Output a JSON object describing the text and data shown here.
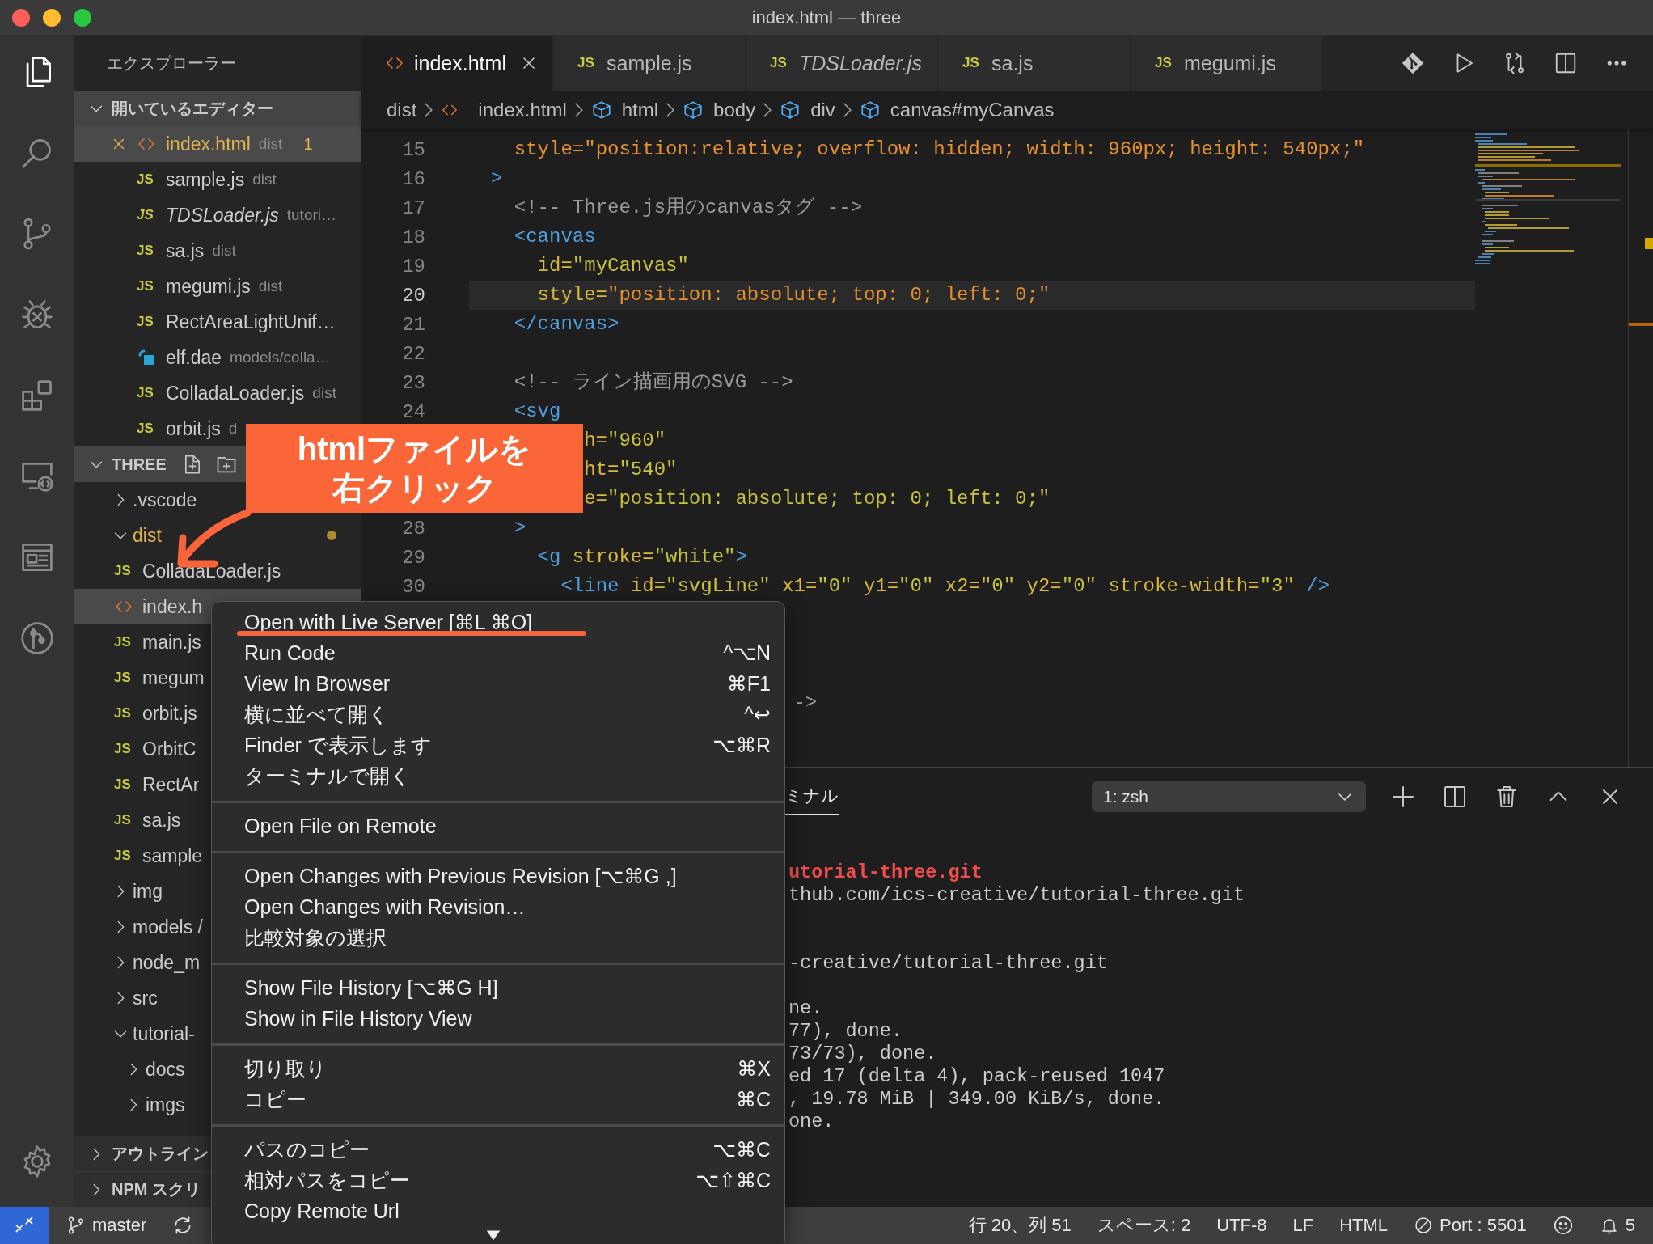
{
  "window": {
    "title": "index.html — three"
  },
  "activity_bar": {
    "items": [
      {
        "kind": "explorer",
        "selected": true
      },
      {
        "kind": "search",
        "selected": false
      },
      {
        "kind": "source-control",
        "selected": false
      },
      {
        "kind": "debug",
        "selected": false
      },
      {
        "kind": "extensions",
        "selected": false
      },
      {
        "kind": "remote",
        "selected": false
      },
      {
        "kind": "preview",
        "selected": false
      },
      {
        "kind": "git-graph",
        "selected": false
      },
      {
        "kind": "settings",
        "selected": false
      }
    ]
  },
  "sidebar": {
    "title": "エクスプローラー",
    "open_editors": {
      "title": "開いているエディター",
      "expanded": true,
      "items": [
        {
          "name": "index.html",
          "description": "dist",
          "kind": "html",
          "badge": "1",
          "selected": true,
          "preview": false,
          "modified": true
        },
        {
          "name": "sample.js",
          "description": "dist",
          "kind": "js",
          "icon": "JS",
          "selected": false,
          "preview": false,
          "modified": false
        },
        {
          "name": "TDSLoader.js",
          "description": "tutori…",
          "kind": "js",
          "icon": "JS",
          "selected": false,
          "preview": true,
          "modified": false
        },
        {
          "name": "sa.js",
          "description": "dist",
          "kind": "js",
          "icon": "JS",
          "selected": false,
          "preview": false,
          "modified": false
        },
        {
          "name": "megumi.js",
          "description": "dist",
          "kind": "js",
          "icon": "JS",
          "selected": false,
          "preview": false,
          "modified": false
        },
        {
          "name": "RectAreaLightUnif…",
          "kind": "js",
          "icon": "JS",
          "selected": false,
          "preview": false,
          "modified": false
        },
        {
          "name": "elf.dae",
          "description": "models/colla…",
          "kind": "dae",
          "selected": false,
          "preview": false,
          "modified": false
        },
        {
          "name": "ColladaLoader.js",
          "description": "dist",
          "kind": "js",
          "icon": "JS",
          "selected": false,
          "preview": false,
          "modified": false
        },
        {
          "name": "orbit.js",
          "description": "d",
          "kind": "js",
          "icon": "JS",
          "selected": false,
          "preview": false,
          "modified": false
        }
      ]
    },
    "folder": {
      "title": "THREE",
      "expanded": true,
      "tree": [
        {
          "name": ".vscode",
          "kind": "folder",
          "expanded": false,
          "selected": false,
          "modified": false
        },
        {
          "name": "dist",
          "kind": "folder",
          "expanded": true,
          "selected": false,
          "modified": true,
          "children": [
            {
              "name": "ColladaLoader.js",
              "kind": "js",
              "icon": "JS",
              "selected": false,
              "modified": false
            },
            {
              "name": "index.h",
              "kind": "html",
              "selected": true,
              "modified": false
            },
            {
              "name": "main.js",
              "kind": "js",
              "icon": "JS",
              "selected": false,
              "modified": false
            },
            {
              "name": "megum",
              "kind": "js",
              "icon": "JS",
              "selected": false,
              "modified": false
            },
            {
              "name": "orbit.js",
              "kind": "js",
              "icon": "JS",
              "selected": false,
              "modified": false
            },
            {
              "name": "OrbitC",
              "kind": "js",
              "icon": "JS",
              "selected": false,
              "modified": false
            },
            {
              "name": "RectAr",
              "kind": "js",
              "icon": "JS",
              "selected": false,
              "modified": false
            },
            {
              "name": "sa.js",
              "kind": "js",
              "icon": "JS",
              "selected": false,
              "modified": false
            },
            {
              "name": "sample",
              "kind": "js",
              "icon": "JS",
              "selected": false,
              "modified": false
            }
          ]
        },
        {
          "name": "img",
          "kind": "folder",
          "expanded": false,
          "selected": false,
          "modified": false
        },
        {
          "name": "models /",
          "kind": "folder",
          "expanded": false,
          "selected": false,
          "modified": false
        },
        {
          "name": "node_m",
          "kind": "folder",
          "expanded": false,
          "selected": false,
          "modified": false
        },
        {
          "name": "src",
          "kind": "folder",
          "expanded": false,
          "selected": false,
          "modified": false
        },
        {
          "name": "tutorial-",
          "kind": "folder",
          "expanded": true,
          "selected": false,
          "modified": false,
          "children": [
            {
              "name": "docs",
              "kind": "folder",
              "expanded": false,
              "selected": false,
              "modified": false
            },
            {
              "name": "imgs",
              "kind": "folder",
              "expanded": false,
              "selected": false,
              "modified": false
            }
          ]
        }
      ]
    },
    "sections": [
      {
        "title": "アウトライン",
        "expanded": false
      },
      {
        "title": "NPM スクリ",
        "expanded": false
      }
    ]
  },
  "editor": {
    "tabs": [
      {
        "name": "index.html",
        "kind": "html",
        "selected": true,
        "preview": false
      },
      {
        "name": "sample.js",
        "kind": "js",
        "icon": "JS",
        "selected": false,
        "preview": false
      },
      {
        "name": "TDSLoader.js",
        "kind": "js",
        "icon": "JS",
        "selected": false,
        "preview": true
      },
      {
        "name": "sa.js",
        "kind": "js",
        "icon": "JS",
        "selected": false,
        "preview": false
      },
      {
        "name": "megumi.js",
        "kind": "js",
        "icon": "JS",
        "selected": false,
        "preview": false
      }
    ],
    "breadcrumbs": [
      {
        "text": "dist",
        "kind": "folder"
      },
      {
        "text": "index.html",
        "kind": "html"
      },
      {
        "text": "html",
        "kind": "element"
      },
      {
        "text": "body",
        "kind": "element"
      },
      {
        "text": "div",
        "kind": "element"
      },
      {
        "text": "canvas#myCanvas",
        "kind": "element"
      }
    ],
    "lines": [
      {
        "number": "15",
        "current": false,
        "tokens": [
          {
            "text": "  style=\"position:relative; overflow: hidden; width: 960px; height: 540px;\"",
            "kind": "css"
          }
        ]
      },
      {
        "number": "16",
        "current": false,
        "tokens": [
          {
            "text": ">",
            "kind": "tag"
          }
        ]
      },
      {
        "number": "17",
        "current": false,
        "tokens": [
          {
            "text": "  <!-- Three.js用のcanvasタグ -->",
            "kind": "comment"
          }
        ]
      },
      {
        "number": "18",
        "current": false,
        "tokens": [
          {
            "text": "  <canvas",
            "kind": "tag"
          }
        ]
      },
      {
        "number": "19",
        "current": false,
        "tokens": [
          {
            "text": "    id=",
            "kind": "attr"
          },
          {
            "text": "\"myCanvas\"",
            "kind": "string"
          }
        ]
      },
      {
        "number": "20",
        "current": true,
        "tokens": [
          {
            "text": "    style=",
            "kind": "attr"
          },
          {
            "text": "\"position: absolute; top: 0; left: 0;\"",
            "kind": "css"
          }
        ]
      },
      {
        "number": "21",
        "current": false,
        "tokens": [
          {
            "text": "  </canvas>",
            "kind": "tag"
          }
        ]
      },
      {
        "number": "22",
        "current": false
      },
      {
        "number": "23",
        "current": false,
        "tokens": [
          {
            "text": "  <!-- ライン描画用のSVG -->",
            "kind": "comment"
          }
        ]
      },
      {
        "number": "24",
        "current": false,
        "tokens": [
          {
            "text": "  <svg",
            "kind": "tag"
          }
        ]
      },
      {
        "current": false,
        "tokens": [
          {
            "text": "        h=",
            "kind": "attr"
          },
          {
            "text": "\"960\"",
            "kind": "string"
          }
        ]
      },
      {
        "current": false,
        "tokens": [
          {
            "text": "        ht=",
            "kind": "attr"
          },
          {
            "text": "\"540\"",
            "kind": "string"
          }
        ]
      },
      {
        "current": false,
        "tokens": [
          {
            "text": "        e=",
            "kind": "attr"
          },
          {
            "text": "\"position: absolute; top: 0; left: 0;\"",
            "kind": "string"
          }
        ]
      },
      {
        "number": "28",
        "current": false,
        "tokens": [
          {
            "text": "  >",
            "kind": "tag"
          }
        ]
      },
      {
        "number": "29",
        "current": false,
        "tokens": [
          {
            "text": "    <g",
            "kind": "tag"
          },
          {
            "text": " stroke=",
            "kind": "attr"
          },
          {
            "text": "\"white\"",
            "kind": "string"
          },
          {
            "text": ">",
            "kind": "tag"
          }
        ]
      },
      {
        "number": "30",
        "current": false,
        "tokens": [
          {
            "text": "      <line",
            "kind": "tag"
          },
          {
            "text": " id=",
            "kind": "attr"
          },
          {
            "text": "\"svgLine\"",
            "kind": "string"
          },
          {
            "text": " x1=",
            "kind": "attr"
          },
          {
            "text": "\"0\"",
            "kind": "string"
          },
          {
            "text": " y1=",
            "kind": "attr"
          },
          {
            "text": "\"0\"",
            "kind": "string"
          },
          {
            "text": " x2=",
            "kind": "attr"
          },
          {
            "text": "\"0\"",
            "kind": "string"
          },
          {
            "text": " y2=",
            "kind": "attr"
          },
          {
            "text": "\"0\"",
            "kind": "string"
          },
          {
            "text": " stroke-width=",
            "kind": "attr"
          },
          {
            "text": "\"3\"",
            "kind": "string"
          },
          {
            "text": " />",
            "kind": "tag"
          }
        ]
      },
      {
        "current": false
      },
      {
        "current": false
      },
      {
        "current": false
      },
      {
        "current": false,
        "tokens": [
          {
            "text": "                          ->",
            "kind": "comment"
          }
        ]
      }
    ]
  },
  "panel": {
    "tab": {
      "label": "ミナル",
      "selected": true
    },
    "terminal_select": "1: zsh",
    "lines": [
      {
        "kind": "error",
        "text": "utorial-three.git"
      },
      {
        "kind": "output",
        "text": "thub.com/ics-creative/tutorial-three.git"
      },
      {
        "kind": "blank"
      },
      {
        "kind": "blank"
      },
      {
        "kind": "output",
        "text": "-creative/tutorial-three.git"
      },
      {
        "kind": "blank"
      },
      {
        "kind": "output",
        "text": "ne."
      },
      {
        "kind": "output",
        "text": "77), done."
      },
      {
        "kind": "output",
        "text": "73/73), done."
      },
      {
        "kind": "output",
        "text": "ed 17 (delta 4), pack-reused 1047"
      },
      {
        "kind": "output",
        "text": ", 19.78 MiB | 349.00 KiB/s, done."
      },
      {
        "kind": "output",
        "text": "one."
      }
    ]
  },
  "context_menu": {
    "groups": [
      [
        {
          "label": "Open with Live Server [⌘L ⌘O]",
          "underlined": true
        },
        {
          "label": "Run Code",
          "shortcut": "^⌥N",
          "underlined": false
        },
        {
          "label": "View In Browser",
          "shortcut": "⌘F1",
          "underlined": false
        },
        {
          "label": "横に並べて開く",
          "shortcut": "^↩",
          "underlined": false
        },
        {
          "label": "Finder で表示します",
          "shortcut": "⌥⌘R",
          "underlined": false
        },
        {
          "label": "ターミナルで開く",
          "underlined": false
        }
      ],
      [
        {
          "label": "Open File on Remote",
          "underlined": false
        }
      ],
      [
        {
          "label": "Open Changes with Previous Revision [⌥⌘G ,]",
          "underlined": false
        },
        {
          "label": "Open Changes with Revision…",
          "underlined": false
        },
        {
          "label": "比較対象の選択",
          "underlined": false
        }
      ],
      [
        {
          "label": "Show File History [⌥⌘G H]",
          "underlined": false
        },
        {
          "label": "Show in File History View",
          "underlined": false
        }
      ],
      [
        {
          "label": "切り取り",
          "shortcut": "⌘X",
          "underlined": false
        },
        {
          "label": "コピー",
          "shortcut": "⌘C",
          "underlined": false
        }
      ],
      [
        {
          "label": "パスのコピー",
          "shortcut": "⌥⌘C",
          "underlined": false
        },
        {
          "label": "相対パスをコピー",
          "shortcut": "⌥⇧⌘C",
          "underlined": false
        },
        {
          "label": "Copy Remote Url",
          "underlined": false
        }
      ]
    ]
  },
  "annotation": {
    "lines": [
      "htmlファイルを",
      "右クリック"
    ]
  },
  "status_bar": {
    "branch": "master",
    "items": [
      "行 20、列 51",
      "スペース: 2",
      "UTF-8",
      "LF",
      "HTML"
    ],
    "port": "Port : 5501",
    "notifications": "5"
  }
}
